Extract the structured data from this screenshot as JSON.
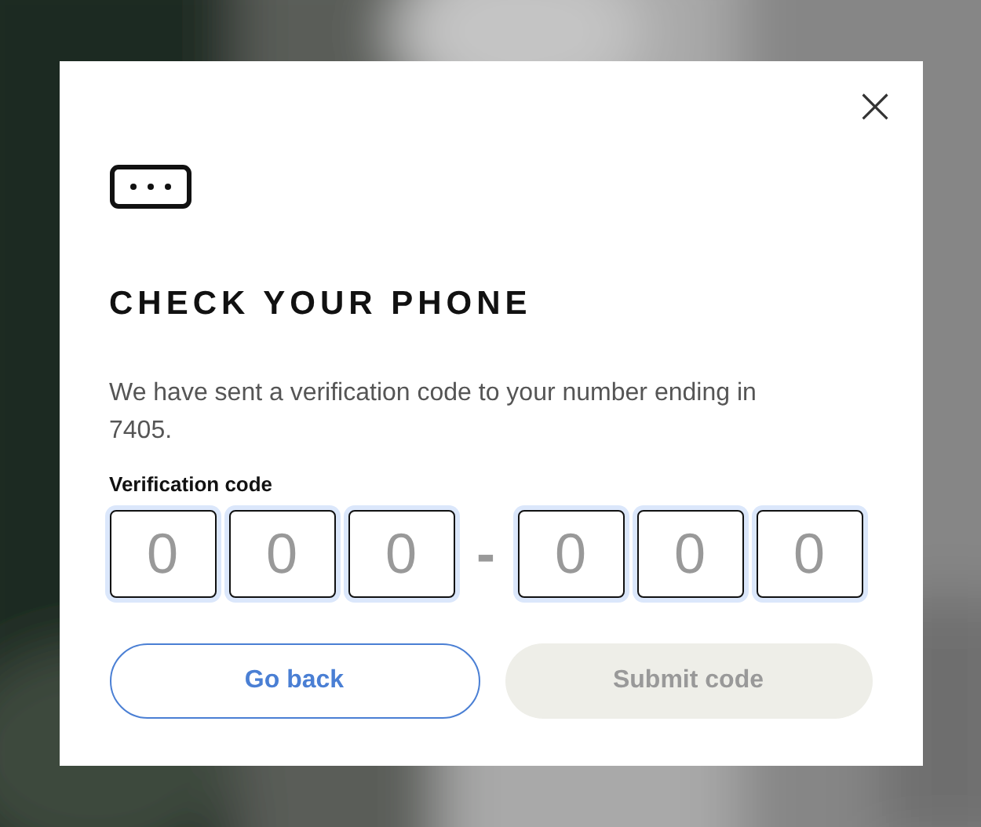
{
  "dialog": {
    "close": "×",
    "title": "CHECK YOUR PHONE",
    "message": "We have sent a verification code to your number ending in 7405.",
    "code_label": "Verification code",
    "code_fields": [
      {
        "placeholder": "0"
      },
      {
        "placeholder": "0"
      },
      {
        "placeholder": "0"
      },
      {
        "kind": "separator",
        "text": "-"
      },
      {
        "placeholder": "0"
      },
      {
        "placeholder": "0"
      },
      {
        "placeholder": "0"
      }
    ],
    "buttons": [
      {
        "label": "Go back",
        "kind": "secondary",
        "disabled": false
      },
      {
        "label": "Submit code",
        "kind": "primary",
        "disabled": true
      }
    ]
  }
}
